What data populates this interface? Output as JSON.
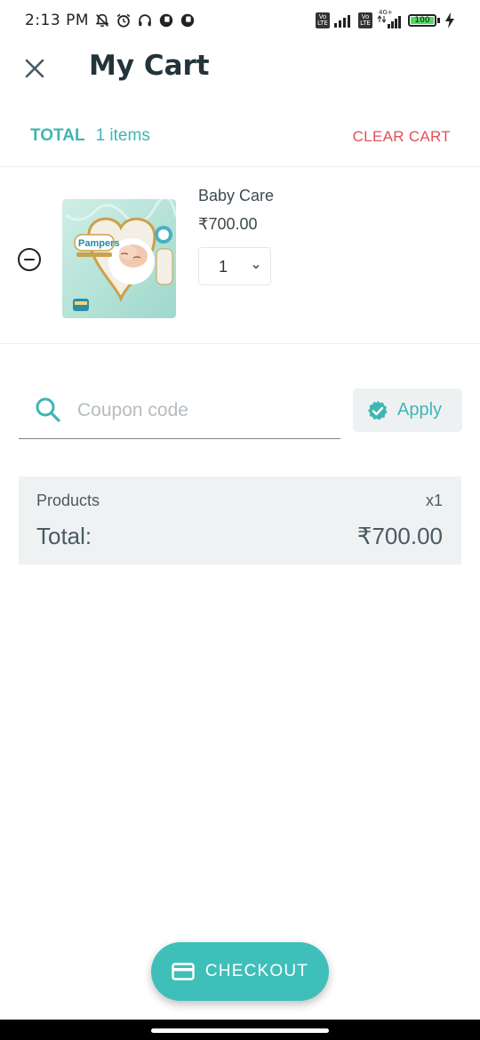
{
  "status_bar": {
    "time": "2:13 PM",
    "left_icons": [
      "muted-bell-icon",
      "alarm-icon",
      "headphones-icon",
      "app-icon",
      "app-icon"
    ],
    "sim1_badge": "Vo LTE",
    "sim2_badge": "Vo LTE",
    "network_label": "4G+",
    "battery_level": "100",
    "battery_fraction": 1.0,
    "charging": true
  },
  "header": {
    "title": "My Cart",
    "close_icon": "close-icon"
  },
  "cart_summary_bar": {
    "total_label": "TOTAL",
    "items_label": "1 items",
    "clear_label": "CLEAR CART"
  },
  "cart_items": [
    {
      "name": "Baby Care",
      "price": "₹700.00",
      "quantity": "1",
      "image_brand_text": "Pampers"
    }
  ],
  "coupon": {
    "placeholder": "Coupon code",
    "value": "",
    "apply_label": "Apply"
  },
  "summary": {
    "products_label": "Products",
    "products_count": "x1",
    "total_label": "Total:",
    "total_value": "₹700.00"
  },
  "checkout": {
    "label": "CHECKOUT"
  },
  "colors": {
    "accent": "#3fb6b3",
    "checkout_bg": "#3fbfba",
    "clear_cart": "#e0505a",
    "summary_bg": "#eff2f3",
    "title": "#23333b"
  }
}
